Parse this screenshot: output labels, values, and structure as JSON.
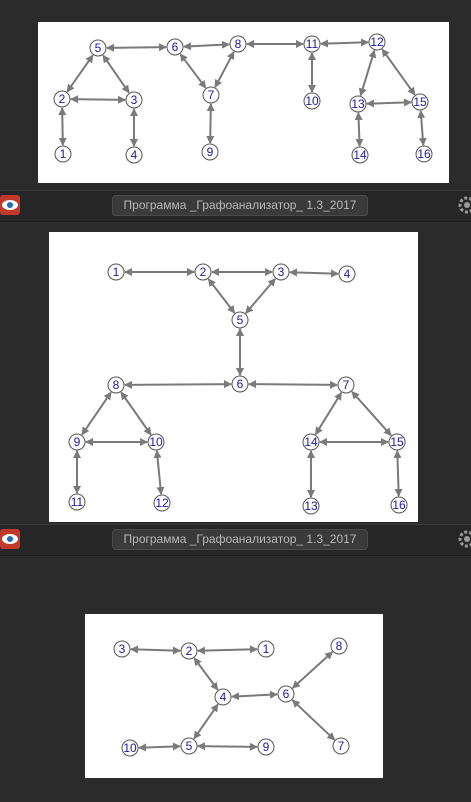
{
  "window_title": "Программа _Графоанализатор_ 1.3_2017",
  "edge_color": "#7a7a7a",
  "label_color": "#1a1aa0",
  "graphs": [
    {
      "nodes": [
        "1",
        "2",
        "3",
        "4",
        "5",
        "6",
        "7",
        "8",
        "9",
        "10",
        "11",
        "12",
        "13",
        "14",
        "15",
        "16"
      ],
      "edges": [
        [
          "2",
          "1"
        ],
        [
          "5",
          "2"
        ],
        [
          "5",
          "3"
        ],
        [
          "2",
          "3"
        ],
        [
          "3",
          "4"
        ],
        [
          "5",
          "6"
        ],
        [
          "6",
          "7"
        ],
        [
          "6",
          "8"
        ],
        [
          "7",
          "8"
        ],
        [
          "7",
          "9"
        ],
        [
          "8",
          "11"
        ],
        [
          "11",
          "12"
        ],
        [
          "11",
          "10"
        ],
        [
          "12",
          "13"
        ],
        [
          "12",
          "15"
        ],
        [
          "13",
          "15"
        ],
        [
          "13",
          "14"
        ],
        [
          "15",
          "16"
        ]
      ]
    },
    {
      "nodes": [
        "1",
        "2",
        "3",
        "4",
        "5",
        "6",
        "7",
        "8",
        "9",
        "10",
        "11",
        "12",
        "13",
        "14",
        "15",
        "16"
      ],
      "edges": [
        [
          "1",
          "2"
        ],
        [
          "2",
          "3"
        ],
        [
          "3",
          "4"
        ],
        [
          "2",
          "5"
        ],
        [
          "3",
          "5"
        ],
        [
          "5",
          "6"
        ],
        [
          "8",
          "6"
        ],
        [
          "6",
          "7"
        ],
        [
          "8",
          "9"
        ],
        [
          "8",
          "10"
        ],
        [
          "9",
          "10"
        ],
        [
          "9",
          "11"
        ],
        [
          "10",
          "12"
        ],
        [
          "7",
          "14"
        ],
        [
          "7",
          "15"
        ],
        [
          "14",
          "15"
        ],
        [
          "14",
          "13"
        ],
        [
          "15",
          "16"
        ]
      ]
    },
    {
      "nodes": [
        "1",
        "2",
        "3",
        "4",
        "5",
        "6",
        "7",
        "8",
        "9",
        "10"
      ],
      "edges": [
        [
          "3",
          "2"
        ],
        [
          "2",
          "1"
        ],
        [
          "2",
          "4"
        ],
        [
          "4",
          "6"
        ],
        [
          "4",
          "5"
        ],
        [
          "6",
          "8"
        ],
        [
          "6",
          "7"
        ],
        [
          "10",
          "5"
        ],
        [
          "5",
          "9"
        ]
      ]
    }
  ]
}
